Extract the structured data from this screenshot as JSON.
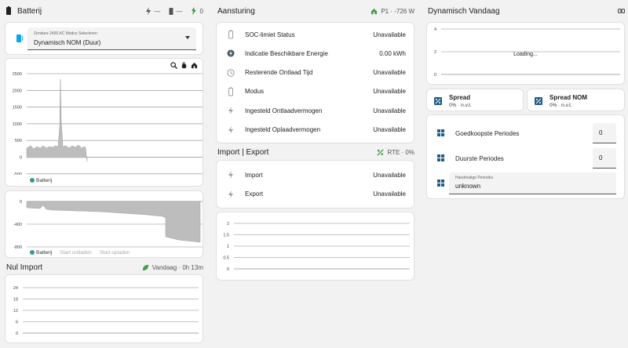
{
  "col1": {
    "title": "Batterij",
    "hdr_items": [
      {
        "icon": "lightning-icon",
        "text": "—"
      },
      {
        "icon": "battery-icon",
        "text": "—"
      },
      {
        "icon": "charging-icon",
        "text": "0"
      }
    ],
    "select": {
      "label": "Zendure 2400 AC Modus Selecteren",
      "value": "Dynamisch NOM (Duur)"
    },
    "chart1": {
      "yticks": [
        "2500",
        "2000",
        "1500",
        "1000",
        "500",
        "0",
        "-500"
      ],
      "legend": [
        "Batterij"
      ]
    },
    "chart2": {
      "yticks": [
        "0",
        "-400",
        "-800"
      ],
      "legend": [
        "Batterij",
        "Start ontladen",
        "Start opladen"
      ]
    },
    "nul_import": {
      "title": "Nul Import",
      "right": "Vandaag · 0h 13m",
      "yticks": [
        "24",
        "18",
        "12",
        "6",
        "0"
      ]
    }
  },
  "col2": {
    "title": "Aansturing",
    "right": "P1 · -726 W",
    "rows": [
      {
        "label": "SOC-limiet Status",
        "value": "Unavailable",
        "icon": "battery-outline-icon"
      },
      {
        "label": "Indicatie Beschikbare Energie",
        "value": "0.00 kWh",
        "icon": "flash-circle-icon"
      },
      {
        "label": "Resterende Ontlaad Tijd",
        "value": "Unavailable",
        "icon": "clock-icon"
      },
      {
        "label": "Modus",
        "value": "Unavailable",
        "icon": "battery-outline-icon"
      },
      {
        "label": "Ingesteld Ontlaadvermogen",
        "value": "Unavailable",
        "icon": "lightning-icon"
      },
      {
        "label": "Ingesteld Oplaadvermogen",
        "value": "Unavailable",
        "icon": "lightning-icon"
      }
    ],
    "import_export": {
      "title": "Import | Export",
      "right": "RTE · 0%",
      "rows": [
        {
          "label": "Import",
          "value": "Unavailable",
          "icon": "lightning-icon"
        },
        {
          "label": "Export",
          "value": "Unavailable",
          "icon": "lightning-icon"
        }
      ]
    },
    "chart3": {
      "yticks": [
        "2",
        "1.5",
        "1",
        "0.5",
        "0"
      ]
    }
  },
  "col3": {
    "title": "Dynamisch Vandaag",
    "chart": {
      "yticks": [
        "4",
        "2",
        "0"
      ],
      "loading": "Loading..."
    },
    "spread": {
      "title": "Spread",
      "value": "0% · n.v.t."
    },
    "spread_nom": {
      "title": "Spread NOM",
      "value": "0% · n.v.t."
    },
    "goedkoopste": {
      "label": "Goedkoopste Periodes",
      "value": "0"
    },
    "duurste": {
      "label": "Duurste Periodes",
      "value": "0"
    },
    "handmatige": {
      "label": "Handmatige Periodes",
      "value": "unknown"
    }
  },
  "colors": {
    "accent": "#03a9f4",
    "green": "#43a047",
    "teal": "#2e9c8f",
    "fill": "#bdbdbd"
  }
}
